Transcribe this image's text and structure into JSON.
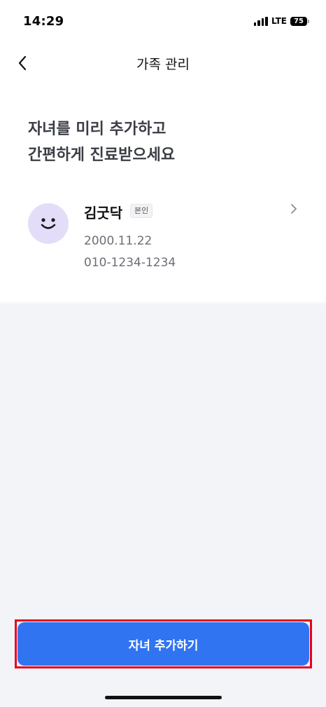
{
  "status_bar": {
    "time": "14:29",
    "network": "LTE",
    "battery": "75"
  },
  "nav": {
    "title": "가족 관리",
    "back_icon": "chevron-left-icon"
  },
  "headline": {
    "line1": "자녀를 미리 추가하고",
    "line2": "간편하게 진료받으세요"
  },
  "member": {
    "name": "김굿닥",
    "badge": "본인",
    "birth": "2000.11.22",
    "phone": "010-1234-1234",
    "avatar_icon": "smiley-face-icon",
    "chevron_icon": "chevron-right-icon"
  },
  "actions": {
    "add_child_label": "자녀 추가하기"
  },
  "colors": {
    "primary": "#3074f1",
    "avatar_bg": "#e3ddf9",
    "highlight_outline": "#e8001c",
    "gray_bg": "#f3f4f8"
  }
}
